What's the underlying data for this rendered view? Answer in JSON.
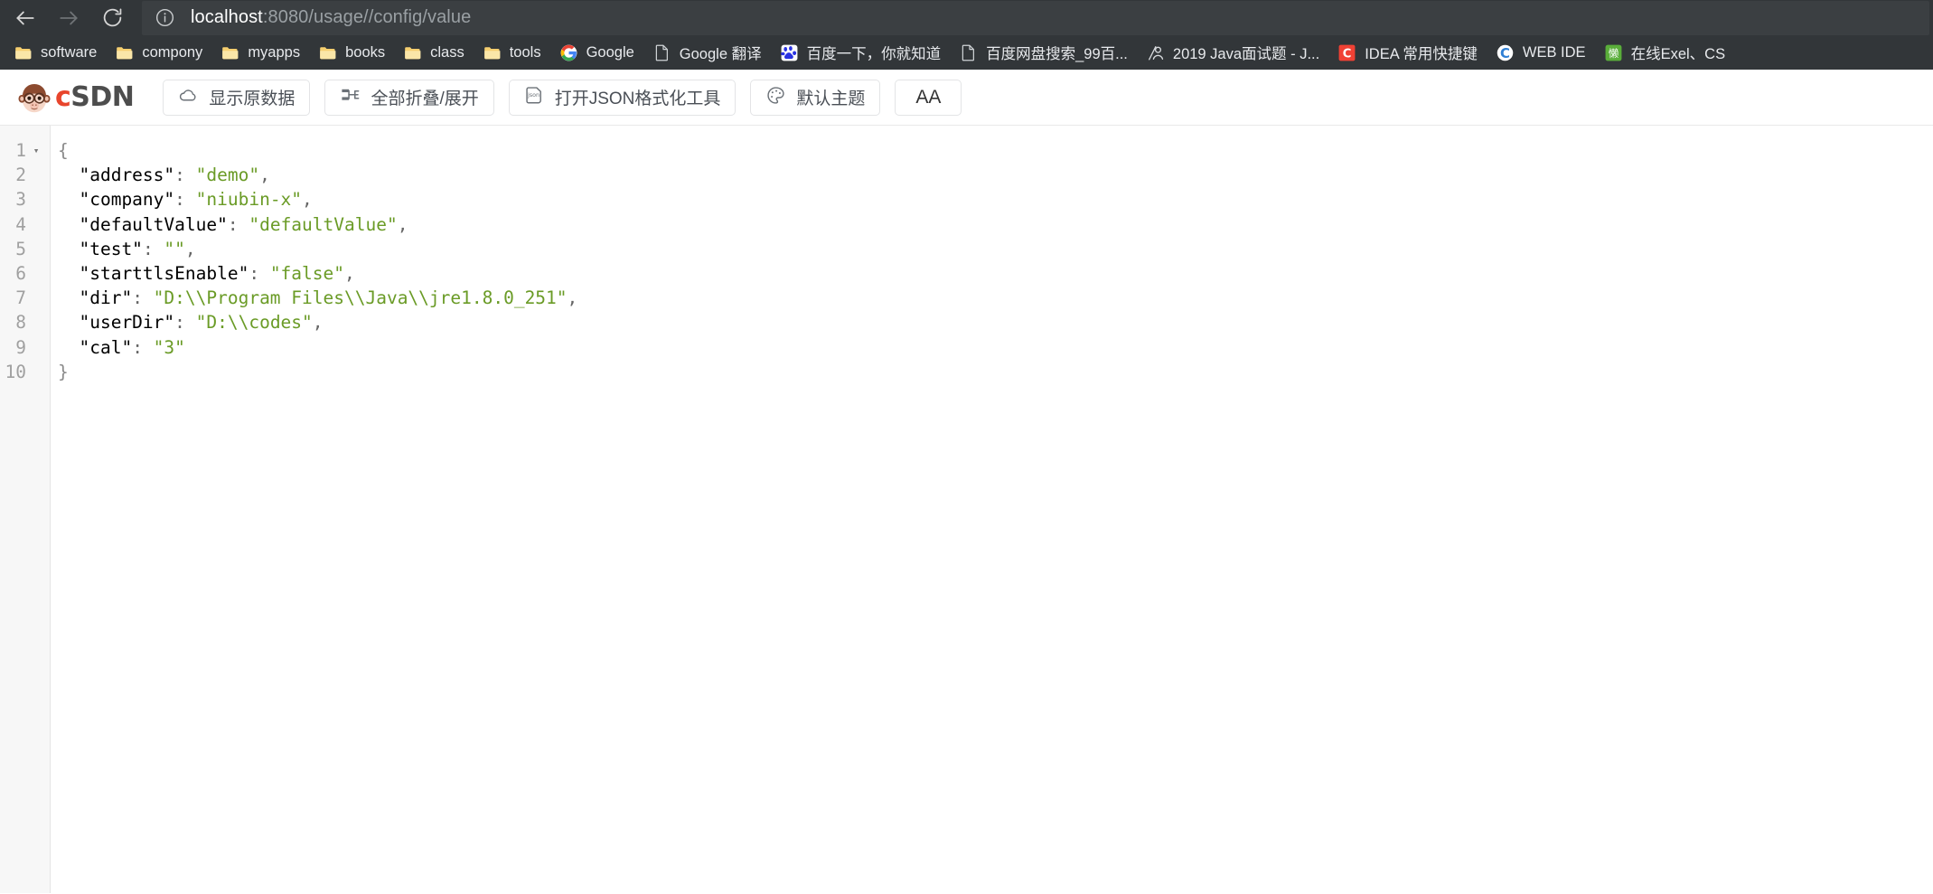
{
  "browser": {
    "nav": {
      "back_icon": "arrow-left-icon",
      "forward_icon": "arrow-right-icon",
      "reload_icon": "reload-icon"
    },
    "omnibox": {
      "info_icon": "site-info-icon",
      "url_host": "localhost",
      "url_rest": ":8080/usage//config/value",
      "url_full": "localhost:8080/usage//config/value"
    },
    "bookmarks": [
      {
        "label": "software",
        "icon": "folder-icon"
      },
      {
        "label": "compony",
        "icon": "folder-icon"
      },
      {
        "label": "myapps",
        "icon": "folder-icon"
      },
      {
        "label": "books",
        "icon": "folder-icon"
      },
      {
        "label": "class",
        "icon": "folder-icon"
      },
      {
        "label": "tools",
        "icon": "folder-icon"
      },
      {
        "label": "Google",
        "icon": "google-icon"
      },
      {
        "label": "Google 翻译",
        "icon": "page-icon"
      },
      {
        "label": "百度一下，你就知道",
        "icon": "baidu-icon"
      },
      {
        "label": "百度网盘搜索_99百...",
        "icon": "page-icon"
      },
      {
        "label": "2019 Java面试题 - J...",
        "icon": "bookmark-person-icon"
      },
      {
        "label": "IDEA 常用快捷键",
        "icon": "csdn-red-icon"
      },
      {
        "label": "WEB IDE",
        "icon": "c-blue-icon"
      },
      {
        "label": "在线Exel、CS",
        "icon": "lan-green-icon"
      }
    ]
  },
  "viewer": {
    "logo": {
      "mascot_icon": "csdn-monkey-icon",
      "wordmark_c": "c",
      "wordmark_sdn": "SDN"
    },
    "toolbar_buttons": [
      {
        "label": "显示原数据",
        "icon": "cloud-icon"
      },
      {
        "label": "全部折叠/展开",
        "icon": "collapse-expand-icon"
      },
      {
        "label": "打开JSON格式化工具",
        "icon": "json-file-icon"
      },
      {
        "label": "默认主题",
        "icon": "palette-icon"
      },
      {
        "label": "AA",
        "icon": "font-size-icon"
      }
    ]
  },
  "editor": {
    "fold_marker": "▾",
    "line_numbers": [
      "1",
      "2",
      "3",
      "4",
      "5",
      "6",
      "7",
      "8",
      "9",
      "10"
    ],
    "lines": [
      {
        "indent": 0,
        "tokens": [
          {
            "t": "brace",
            "v": "{"
          }
        ]
      },
      {
        "indent": 1,
        "tokens": [
          {
            "t": "key",
            "v": "\"address\""
          },
          {
            "t": "punct",
            "v": ": "
          },
          {
            "t": "str",
            "v": "\"demo\""
          },
          {
            "t": "punct",
            "v": ","
          }
        ]
      },
      {
        "indent": 1,
        "tokens": [
          {
            "t": "key",
            "v": "\"company\""
          },
          {
            "t": "punct",
            "v": ": "
          },
          {
            "t": "str",
            "v": "\"niubin-x\""
          },
          {
            "t": "punct",
            "v": ","
          }
        ]
      },
      {
        "indent": 1,
        "tokens": [
          {
            "t": "key",
            "v": "\"defaultValue\""
          },
          {
            "t": "punct",
            "v": ": "
          },
          {
            "t": "str",
            "v": "\"defaultValue\""
          },
          {
            "t": "punct",
            "v": ","
          }
        ]
      },
      {
        "indent": 1,
        "tokens": [
          {
            "t": "key",
            "v": "\"test\""
          },
          {
            "t": "punct",
            "v": ": "
          },
          {
            "t": "str",
            "v": "\"\""
          },
          {
            "t": "punct",
            "v": ","
          }
        ]
      },
      {
        "indent": 1,
        "tokens": [
          {
            "t": "key",
            "v": "\"starttlsEnable\""
          },
          {
            "t": "punct",
            "v": ": "
          },
          {
            "t": "str",
            "v": "\"false\""
          },
          {
            "t": "punct",
            "v": ","
          }
        ]
      },
      {
        "indent": 1,
        "tokens": [
          {
            "t": "key",
            "v": "\"dir\""
          },
          {
            "t": "punct",
            "v": ": "
          },
          {
            "t": "str",
            "v": "\"D:\\\\Program Files\\\\Java\\\\jre1.8.0_251\""
          },
          {
            "t": "punct",
            "v": ","
          }
        ]
      },
      {
        "indent": 1,
        "tokens": [
          {
            "t": "key",
            "v": "\"userDir\""
          },
          {
            "t": "punct",
            "v": ": "
          },
          {
            "t": "str",
            "v": "\"D:\\\\codes\""
          },
          {
            "t": "punct",
            "v": ","
          }
        ]
      },
      {
        "indent": 1,
        "tokens": [
          {
            "t": "key",
            "v": "\"cal\""
          },
          {
            "t": "punct",
            "v": ": "
          },
          {
            "t": "str",
            "v": "\"3\""
          }
        ]
      },
      {
        "indent": 0,
        "tokens": [
          {
            "t": "brace",
            "v": "}"
          }
        ]
      }
    ],
    "json_object": {
      "address": "demo",
      "company": "niubin-x",
      "defaultValue": "defaultValue",
      "test": "",
      "starttlsEnable": "false",
      "dir": "D:\\Program Files\\Java\\jre1.8.0_251",
      "userDir": "D:\\codes",
      "cal": "3"
    }
  },
  "colors": {
    "chrome_bg": "#323639",
    "omnibox_bg": "#3b3f42",
    "json_string": "#6a9b26",
    "csdn_red": "#e8452c",
    "gutter_bg": "#f7f7f7"
  }
}
